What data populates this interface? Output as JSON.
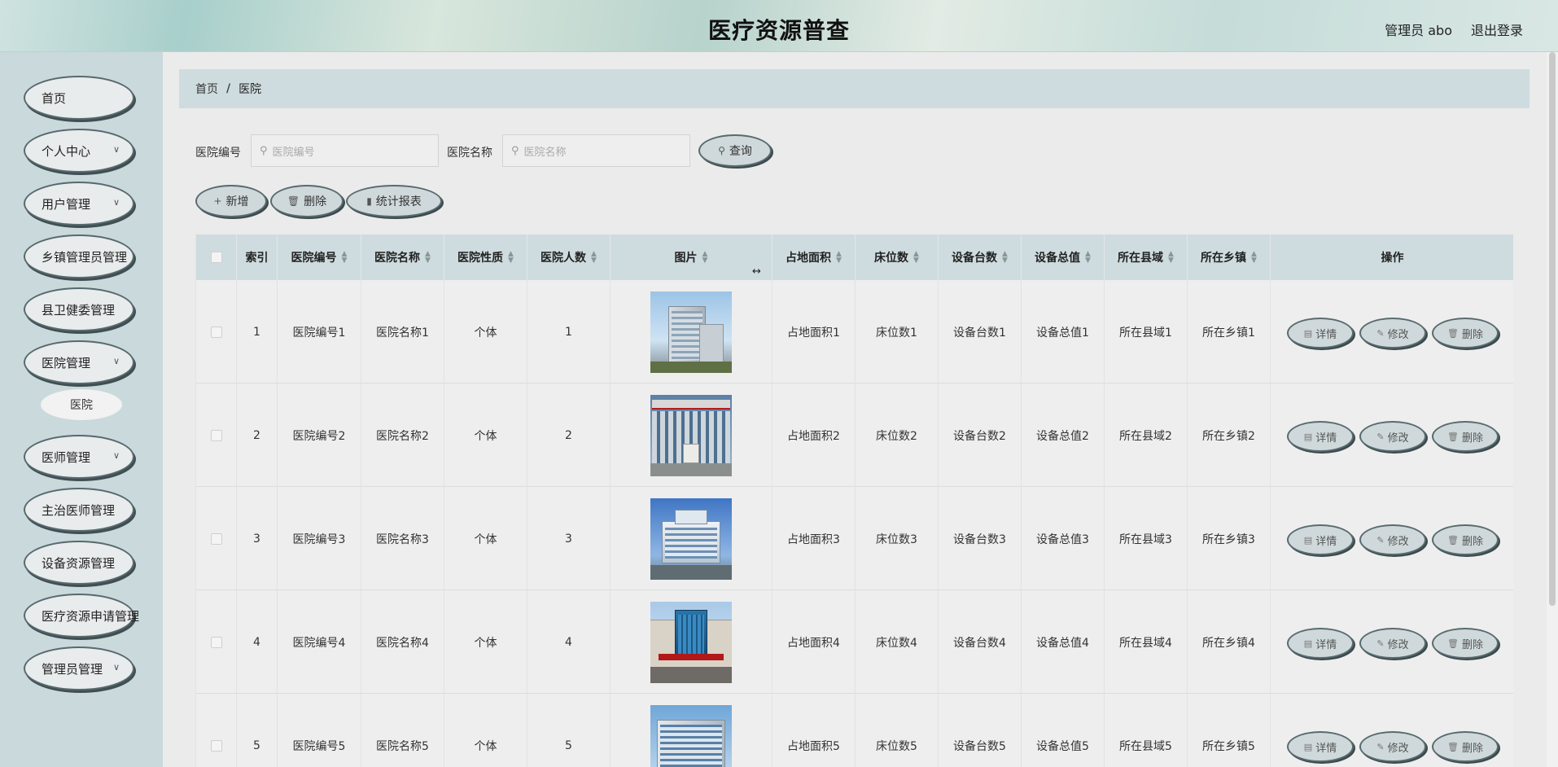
{
  "header": {
    "title": "医疗资源普查",
    "user": "管理员 abo",
    "logout": "退出登录"
  },
  "sidebar": {
    "items": [
      {
        "label": "首页",
        "has_children": false
      },
      {
        "label": "个人中心",
        "has_children": true
      },
      {
        "label": "用户管理",
        "has_children": true
      },
      {
        "label": "乡镇管理员管理",
        "has_children": false
      },
      {
        "label": "县卫健委管理",
        "has_children": false
      },
      {
        "label": "医院管理",
        "has_children": true
      },
      {
        "label": "医师管理",
        "has_children": true
      },
      {
        "label": "主治医师管理",
        "has_children": false
      },
      {
        "label": "设备资源管理",
        "has_children": false
      },
      {
        "label": "医疗资源申请管理",
        "has_children": false
      },
      {
        "label": "管理员管理",
        "has_children": true
      }
    ],
    "submenu_label": "医院"
  },
  "breadcrumb": {
    "home": "首页",
    "separator": "/",
    "current": "医院"
  },
  "search": {
    "code_label": "医院编号",
    "code_placeholder": "医院编号",
    "name_label": "医院名称",
    "name_placeholder": "医院名称",
    "query_button": "查询"
  },
  "toolbar": {
    "add": "新增",
    "delete": "删除",
    "report": "统计报表"
  },
  "table": {
    "columns": [
      "索引",
      "医院编号",
      "医院名称",
      "医院性质",
      "医院人数",
      "图片",
      "占地面积",
      "床位数",
      "设备台数",
      "设备总值",
      "所在县域",
      "所在乡镇",
      "操作"
    ],
    "actions": {
      "detail": "详情",
      "edit": "修改",
      "delete": "删除"
    },
    "rows": [
      {
        "index": "1",
        "code": "医院编号1",
        "name": "医院名称1",
        "nature": "个体",
        "staff": "1",
        "area": "占地面积1",
        "beds": "床位数1",
        "devices": "设备台数1",
        "value": "设备总值1",
        "county": "所在县域1",
        "town": "所在乡镇1"
      },
      {
        "index": "2",
        "code": "医院编号2",
        "name": "医院名称2",
        "nature": "个体",
        "staff": "2",
        "area": "占地面积2",
        "beds": "床位数2",
        "devices": "设备台数2",
        "value": "设备总值2",
        "county": "所在县域2",
        "town": "所在乡镇2"
      },
      {
        "index": "3",
        "code": "医院编号3",
        "name": "医院名称3",
        "nature": "个体",
        "staff": "3",
        "area": "占地面积3",
        "beds": "床位数3",
        "devices": "设备台数3",
        "value": "设备总值3",
        "county": "所在县域3",
        "town": "所在乡镇3"
      },
      {
        "index": "4",
        "code": "医院编号4",
        "name": "医院名称4",
        "nature": "个体",
        "staff": "4",
        "area": "占地面积4",
        "beds": "床位数4",
        "devices": "设备台数4",
        "value": "设备总值4",
        "county": "所在县域4",
        "town": "所在乡镇4"
      },
      {
        "index": "5",
        "code": "医院编号5",
        "name": "医院名称5",
        "nature": "个体",
        "staff": "5",
        "area": "占地面积5",
        "beds": "床位数5",
        "devices": "设备台数5",
        "value": "设备总值5",
        "county": "所在县域5",
        "town": "所在乡镇5"
      }
    ]
  },
  "icons": {
    "search": "search-icon",
    "add": "plus-icon",
    "delete": "trash-icon",
    "report": "bar-chart-icon",
    "detail": "document-icon",
    "edit": "pencil-icon",
    "sort": "sort-caret-icon",
    "chevron": "chevron-down-icon"
  },
  "colors": {
    "sidebar_bg": "#c9d9dc",
    "breadcrumb_bg": "#cfdcdf",
    "button_fill": "#cfd9db",
    "button_border": "#596b6e"
  }
}
